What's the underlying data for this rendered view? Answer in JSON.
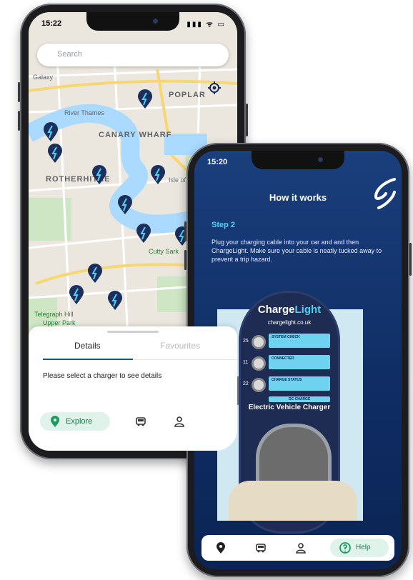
{
  "phone_map": {
    "status": {
      "time": "15:22",
      "icons": "▮▮▮ ᯤ ▭"
    },
    "search": {
      "placeholder": "Search"
    },
    "map_labels": {
      "galaxy": "Galaxy",
      "poplar": "POPLAR",
      "canary_wharf": "CANARY WHARF",
      "rotherhithe": "ROTHERHITHE",
      "isle_of_dogs": "Isle of Dogs",
      "cutty_sark": "Cutty Sark",
      "telegraph_hill": "Telegraph Hill",
      "upper_park": "Upper Park",
      "river_thames": "River Thames"
    },
    "sheet": {
      "tabs": [
        "Details",
        "Favourites"
      ],
      "hint": "Please select a charger to see details"
    },
    "nav": {
      "explore": "Explore"
    },
    "icons": [
      "location-pin-icon",
      "car-icon",
      "user-icon",
      "crosshair-icon",
      "search-icon"
    ],
    "colors": {
      "pin": "#1b2e5c",
      "accent": "#00628a",
      "explore_pill": "#dff3ea"
    }
  },
  "phone_guide": {
    "status": {
      "time": "15:20"
    },
    "title": "How it works",
    "step": "Step 2",
    "description": "Plug your charging cable into your car and and then ChargeLight. Make sure your cable is neatly tucked away to prevent a trip hazard.",
    "charger": {
      "brand_a": "Charge",
      "brand_b": "Light",
      "url": "chargelight.co.uk",
      "rows": [
        {
          "num": "25",
          "label": "SYSTEM CHECK"
        },
        {
          "num": "11",
          "label": "CONNECTED"
        },
        {
          "num": "22",
          "label": "CHARGE STATUS"
        }
      ],
      "bar": "DC CHARGE",
      "caption": "Electric Vehicle Charger"
    },
    "nav": {
      "help": "Help"
    },
    "icons": [
      "location-pin-icon",
      "car-icon",
      "user-icon",
      "help-icon"
    ],
    "colors": {
      "bg": "#0f2c63",
      "step": "#4fd1f5",
      "panel": "#6fd3ef"
    }
  }
}
